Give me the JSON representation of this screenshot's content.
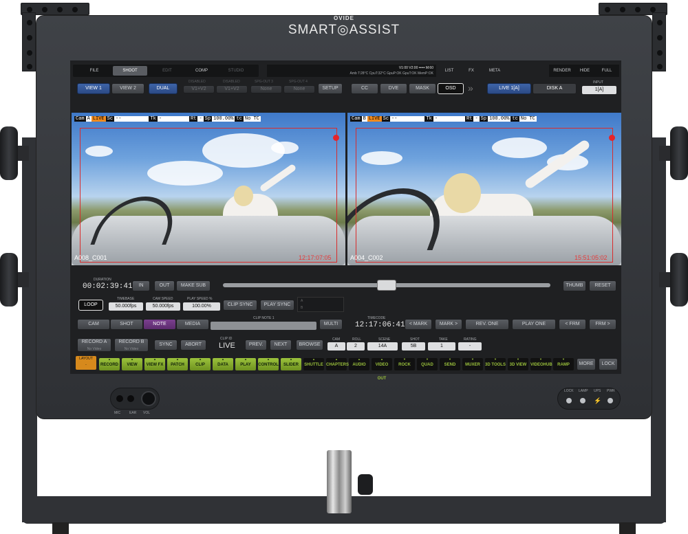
{
  "brand": {
    "maker": "OVIDE",
    "product": "SMART◎ASSIST"
  },
  "menu": {
    "file": "FILE",
    "shoot": "SHOOT",
    "edit": "EDIT",
    "comp": "COMP",
    "studio": "STUDIO",
    "list": "LIST",
    "fx": "FX",
    "meta": "META",
    "render": "RENDER",
    "hide": "HIDE",
    "full": "FULL"
  },
  "status": {
    "line1": "V1:00 V2:00 ••••• M:60",
    "line2": "Amb T:28°C CpuT:32°C GpuP:OK GpuT:OK MemP:OK"
  },
  "view": {
    "view1": "VIEW 1",
    "view2": "VIEW 2",
    "dual": "DUAL",
    "disabled1": "DISABLED",
    "v1v2a": "V1+V2",
    "disabled2": "DISABLED",
    "v1v2b": "V1+V2",
    "sdi3_label": "SPG-OUT 3",
    "sdi3": "None",
    "sdi4_label": "SPG-OUT 4",
    "sdi4": "None",
    "setup": "SETUP",
    "cc": "CC",
    "dve": "DVE",
    "mask": "MASK",
    "osd": "OSD",
    "live1": "LIVE 1[A]",
    "diska": "DISK A",
    "input_label": "INPUT",
    "input": "1[A]"
  },
  "videoA": {
    "cam_k": "Cam",
    "cam_v": "A",
    "live": "LIVE",
    "sc_k": "Sc",
    "sc_v": "--",
    "tk_k": "Tk",
    "tk_v": "-",
    "rt_k": "Rt",
    "rt_v": "-",
    "sp_k": "Sp",
    "sp_v": "100.00%",
    "tc_k": "tc",
    "tc_v": "No TC",
    "clip": "A008_C001",
    "timecode": "12:17:07:05"
  },
  "videoB": {
    "cam_k": "Cam",
    "cam_v": "B",
    "live": "LIVE",
    "sc_k": "Sc",
    "sc_v": "--",
    "tk_k": "Tk",
    "tk_v": "-",
    "rt_k": "Rt",
    "rt_v": "-",
    "sp_k": "Sp",
    "sp_v": "100.00%",
    "tc_k": "tc",
    "tc_v": "No TC",
    "clip": "A004_C002",
    "timecode": "15:51:05:02"
  },
  "transport": {
    "duration_label": "DURATION",
    "duration": "00:02:39:41",
    "in": "IN",
    "out": "OUT",
    "makesub": "MAKE SUB",
    "thumb": "THUMB",
    "reset": "RESET",
    "scrub": 0.5
  },
  "play": {
    "loop": "LOOP",
    "timebase_label": "TIMEBASE",
    "timebase": "50.000fps",
    "camspeed_label": "CAM SPEED",
    "camspeed": "50.000fps",
    "playspeed_label": "PLAY SPEED %",
    "playspeed": "100.00%",
    "clipsync": "CLIP SYNC",
    "playsync": "PLAY SYNC",
    "a": "A",
    "b": "B"
  },
  "notes": {
    "cam": "CAM",
    "shot": "SHOT",
    "note": "NOTE",
    "media": "MEDIA",
    "clipnote_label": "CLIP NOTE 1",
    "multi": "MULTI",
    "timecode_label": "TIMECODE",
    "timecode": "12:17:06:41",
    "mark_prev": "< MARK",
    "mark_next": "MARK >",
    "revone": "REV. ONE",
    "playone": "PLAY ONE",
    "frm_prev": "< FRM",
    "frm_next": "FRM >"
  },
  "record": {
    "reca": "RECORD A",
    "reca_sub": "No Video",
    "recb": "RECORD B",
    "recb_sub": "No Video",
    "sync": "SYNC",
    "abort": "ABORT",
    "clipid_label": "CLIP ID",
    "clipid": "LIVE",
    "prev": "PREV.",
    "next": "NEXT",
    "browse": "BROWSE",
    "cam_label": "CAM",
    "cam": "A",
    "roll_label": "ROLL",
    "roll": "2",
    "scene_label": "SCENE",
    "scene": "14A",
    "shot_label": "SHOT",
    "shot": "5B",
    "take_label": "TAKE",
    "take": "1",
    "rating_label": "RATING",
    "rating": "-"
  },
  "bottom": {
    "layout_label": "LAYOUT",
    "layout": "-",
    "record": "RECORD",
    "view": "VIEW",
    "viewfx": "VIEW FX",
    "patch": "PATCH",
    "clip": "CLIP",
    "data": "DATA",
    "play": "PLAY",
    "control": "CONTROL",
    "slider": "SLIDER",
    "shuttle": "SHUTTLE",
    "chapters": "CHAPTERS",
    "audio": "AUDIO",
    "videoout": "VIDEO OUT",
    "rock": "ROCK",
    "quad": "QUAD",
    "send": "SEND",
    "muxer": "MUXER",
    "tools3d": "3D TOOLS",
    "view3d": "3D VIEW",
    "videohub": "VIDEOHUB",
    "ramp": "RAMP",
    "more": "MORE",
    "lock": "LOCK"
  },
  "hw": {
    "mic": "MIC",
    "ear": "EAR",
    "vol": "VOL",
    "lock": "LOCK",
    "lamp": "LAMP",
    "ups": "UPS",
    "pwr": "PWR"
  }
}
